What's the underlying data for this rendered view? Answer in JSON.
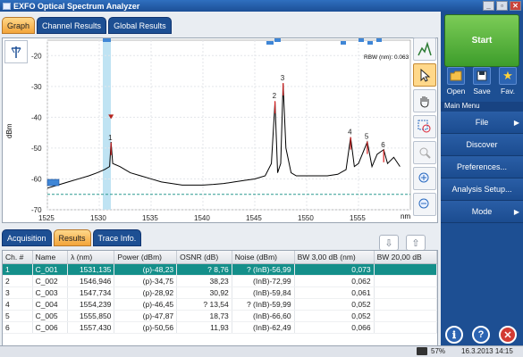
{
  "window": {
    "title": "EXFO Optical Spectrum Analyzer",
    "buttons": [
      "_",
      "▫",
      "✕"
    ]
  },
  "graph_tabs": [
    {
      "label": "Graph",
      "active": true
    },
    {
      "label": "Channel Results",
      "active": false
    },
    {
      "label": "Global Results",
      "active": false
    }
  ],
  "graph": {
    "rbw_label": "RBW (nm): 0.063",
    "y_axis_label": "dBm",
    "x_unit": "nm",
    "peak_labels": [
      "1",
      "2",
      "3",
      "4",
      "5",
      "6"
    ]
  },
  "chart_data": {
    "type": "line",
    "xlabel": "nm",
    "ylabel": "dBm",
    "xlim": [
      1525,
      1560
    ],
    "ylim": [
      -70,
      -15
    ],
    "x_ticks": [
      1525,
      1530,
      1535,
      1540,
      1545,
      1550,
      1555
    ],
    "y_ticks": [
      -20,
      -30,
      -40,
      -50,
      -60,
      -70
    ],
    "noise_floor_dashed": -65,
    "series": [
      {
        "x": [
          1525,
          1526,
          1527,
          1528,
          1529,
          1529.8,
          1530.5,
          1531.0,
          1531.14,
          1531.3,
          1532,
          1533,
          1534,
          1535,
          1536,
          1537,
          1538,
          1539,
          1540,
          1541,
          1542,
          1543,
          1544,
          1545,
          1546,
          1546.6,
          1546.95,
          1547.2,
          1547.5,
          1547.73,
          1548,
          1548.5,
          1549,
          1550,
          1551,
          1552,
          1553,
          1553.8,
          1554.24,
          1554.6,
          1555,
          1555.85,
          1556.3,
          1556.8,
          1557.43,
          1557.8,
          1558.4,
          1559
        ],
        "y": [
          -63,
          -62,
          -61,
          -60,
          -59,
          -58,
          -57,
          -56,
          -48,
          -55,
          -56,
          -58,
          -59,
          -60,
          -61,
          -61.5,
          -62,
          -62,
          -62,
          -61.8,
          -61.5,
          -61,
          -60.5,
          -60,
          -59,
          -55,
          -35,
          -58,
          -55,
          -29,
          -50,
          -58,
          -59,
          -59,
          -59,
          -59,
          -58.5,
          -57,
          -46.5,
          -56,
          -55,
          -48,
          -56,
          -52,
          -50.5,
          -55,
          -53,
          -56
        ]
      }
    ]
  },
  "result_tabs": [
    {
      "label": "Acquisition",
      "active": false
    },
    {
      "label": "Results",
      "active": true
    },
    {
      "label": "Trace Info.",
      "active": false
    }
  ],
  "table": {
    "columns": [
      "Ch. #",
      "Name",
      "λ (nm)",
      "Power (dBm)",
      "OSNR (dB)",
      "Noise (dBm)",
      "BW 3,00 dB (nm)",
      "BW 20,00 dB"
    ],
    "rows": [
      [
        "1",
        "C_001",
        "1531,135",
        "(p)-48,23",
        "? 8,76",
        "? (InB)-56,99",
        "0,073",
        ""
      ],
      [
        "2",
        "C_002",
        "1546,946",
        "(p)-34,75",
        "38,23",
        "(InB)-72,99",
        "0,062",
        ""
      ],
      [
        "3",
        "C_003",
        "1547,734",
        "(p)-28,92",
        "30,92",
        "(InB)-59,84",
        "0,061",
        ""
      ],
      [
        "4",
        "C_004",
        "1554,239",
        "(p)-46,45",
        "? 13,54",
        "? (InB)-59,99",
        "0,052",
        ""
      ],
      [
        "5",
        "C_005",
        "1555,850",
        "(p)-47,87",
        "18,73",
        "(InB)-66,60",
        "0,052",
        ""
      ],
      [
        "6",
        "C_006",
        "1557,430",
        "(p)-50,56",
        "11,93",
        "(InB)-62,49",
        "0,066",
        ""
      ]
    ]
  },
  "sidebar": {
    "start_label": "Start",
    "quick": [
      {
        "label": "Open",
        "icon": "folder-icon"
      },
      {
        "label": "Save",
        "icon": "save-icon"
      },
      {
        "label": "Fav.",
        "icon": "star-icon"
      }
    ],
    "menu_title": "Main Menu",
    "menu": [
      {
        "label": "File",
        "arrow": "▶"
      },
      {
        "label": "Discover",
        "arrow": ""
      },
      {
        "label": "Preferences...",
        "arrow": ""
      },
      {
        "label": "Analysis Setup...",
        "arrow": ""
      },
      {
        "label": "Mode",
        "arrow": "▶"
      }
    ],
    "bottom_buttons": [
      "ℹ",
      "?",
      "✕"
    ]
  },
  "status": {
    "battery": "57%",
    "datetime": "16.3.2013 14:15"
  },
  "colors": {
    "trace": "#000000",
    "peak_marker": "#d81e1e",
    "highlight": "#bfe3f3",
    "noise_dashed": "#2b9a8f",
    "selection_row": "#148f8a"
  }
}
